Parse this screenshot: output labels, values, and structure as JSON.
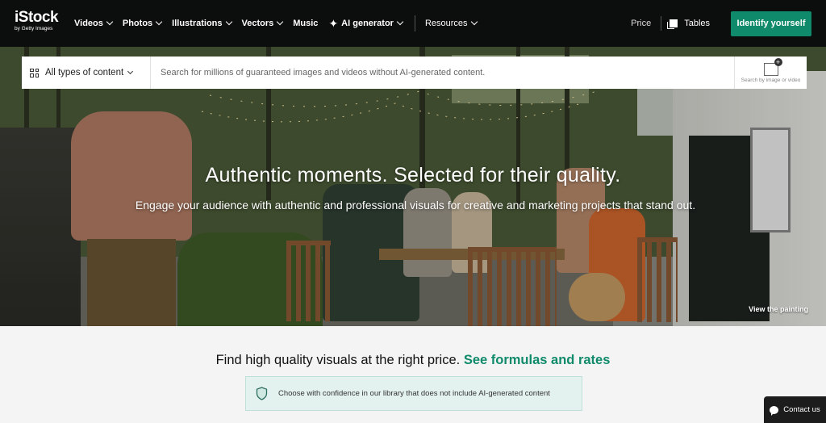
{
  "logo": {
    "name": "iStock",
    "tagline": "by Getty Images"
  },
  "nav": {
    "items": [
      {
        "label": "Videos",
        "has_dropdown": true
      },
      {
        "label": "Photos",
        "has_dropdown": true
      },
      {
        "label": "Illustrations",
        "has_dropdown": true
      },
      {
        "label": "Vectors",
        "has_dropdown": true
      },
      {
        "label": "Music",
        "has_dropdown": false
      },
      {
        "label": "AI generator",
        "has_dropdown": true,
        "icon": "sparkle-icon"
      },
      {
        "label": "Resources",
        "has_dropdown": true
      }
    ],
    "price_label": "Price",
    "tables_label": "Tables",
    "cta_label": "Identify yourself"
  },
  "search": {
    "content_type": "All types of content",
    "placeholder": "Search for millions of guaranteed images and videos without AI-generated content.",
    "image_search_label": "Search by image or video"
  },
  "hero": {
    "title": "Authentic moments. Selected for their quality.",
    "subtitle": "Engage your audience with authentic and professional visuals for creative and marketing projects that stand out.",
    "view_link": "View the painting"
  },
  "pricing": {
    "text": "Find high quality visuals at the right price.",
    "link": "See formulas and rates"
  },
  "notice": {
    "text": "Choose with confidence in our library that does not include AI-generated content"
  },
  "contact": {
    "label": "Contact us"
  },
  "colors": {
    "accent": "#0f8a6a",
    "topbar": "#0c0d0d",
    "notice_bg": "#e3f2ef"
  }
}
